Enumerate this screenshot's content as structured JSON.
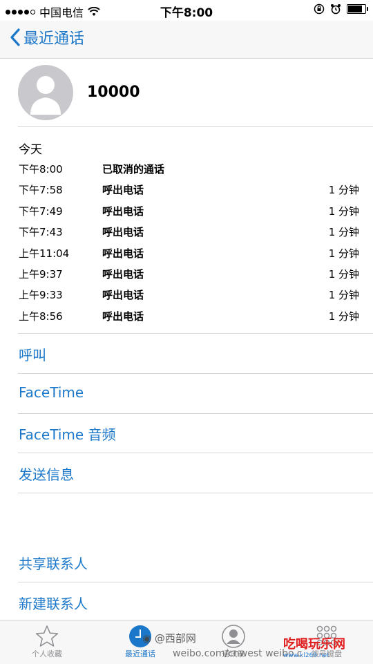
{
  "status_bar": {
    "carrier": "中国电信",
    "time": "下午8:00"
  },
  "nav": {
    "back_label": "最近通话"
  },
  "contact": {
    "name": "10000"
  },
  "call_log": {
    "day": "今天",
    "entries": [
      {
        "time": "下午8:00",
        "type": "已取消的通话",
        "duration": ""
      },
      {
        "time": "下午7:58",
        "type": "呼出电话",
        "duration": "1 分钟"
      },
      {
        "time": "下午7:49",
        "type": "呼出电话",
        "duration": "1 分钟"
      },
      {
        "time": "下午7:43",
        "type": "呼出电话",
        "duration": "1 分钟"
      },
      {
        "time": "上午11:04",
        "type": "呼出电话",
        "duration": "1 分钟"
      },
      {
        "time": "上午9:37",
        "type": "呼出电话",
        "duration": "1 分钟"
      },
      {
        "time": "上午9:33",
        "type": "呼出电话",
        "duration": "1 分钟"
      },
      {
        "time": "上午8:56",
        "type": "呼出电话",
        "duration": "1 分钟"
      }
    ]
  },
  "actions": {
    "call": "呼叫",
    "facetime": "FaceTime",
    "facetime_audio": "FaceTime 音频",
    "send_message": "发送信息",
    "share_contact": "共享联系人",
    "new_contact": "新建联系人"
  },
  "tab_bar": {
    "favorites": "个人收藏",
    "recents": "最近通话",
    "contacts": "通讯录",
    "keypad": "拨号键盘"
  },
  "watermark": {
    "line1": "@西部网",
    "line2": "weibo.com/cnwest",
    "line3": "weibo.c",
    "logo_text": "吃喝玩乐网",
    "logo_url": "www.kl269.net"
  },
  "colors": {
    "accent": "#1b77c9",
    "separator": "#d6d6d6",
    "bar_background": "#f7f7f7"
  }
}
